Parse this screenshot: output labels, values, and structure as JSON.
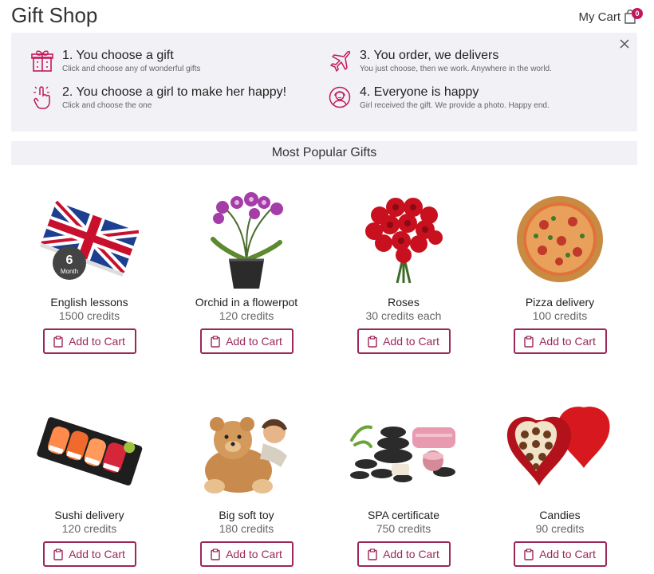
{
  "header": {
    "title": "Gift Shop",
    "cart_label": "My Cart",
    "cart_count": "0"
  },
  "steps": [
    {
      "title": "1. You choose a gift",
      "desc": "Click and choose any of wonderful gifts",
      "icon": "gift-icon"
    },
    {
      "title": "2. You choose a girl to make her happy!",
      "desc": "Click and choose the one",
      "icon": "hand-pointer-icon"
    },
    {
      "title": "3. You order, we delivers",
      "desc": "You just choose, then we work. Anywhere in the world.",
      "icon": "airplane-icon"
    },
    {
      "title": "4. Everyone is happy",
      "desc": "Girl received the gift. We provide a photo. Happy end.",
      "icon": "happy-girl-icon"
    }
  ],
  "popular": {
    "title": "Most Popular Gifts"
  },
  "products": [
    {
      "name": "English lessons",
      "price": "1500 credits",
      "badge_number": "6",
      "badge_unit": "Month"
    },
    {
      "name": "Orchid in a flowerpot",
      "price": "120 credits"
    },
    {
      "name": "Roses",
      "price": "30 credits each"
    },
    {
      "name": "Pizza delivery",
      "price": "100 credits"
    },
    {
      "name": "Sushi delivery",
      "price": "120 credits"
    },
    {
      "name": "Big soft toy",
      "price": "180 credits"
    },
    {
      "name": "SPA certificate",
      "price": "750 credits"
    },
    {
      "name": "Candies",
      "price": "90 credits"
    }
  ],
  "button_label": "Add to Cart",
  "colors": {
    "accent": "#9c2759",
    "badge": "#c2185b",
    "panel": "#f2f2f6"
  }
}
